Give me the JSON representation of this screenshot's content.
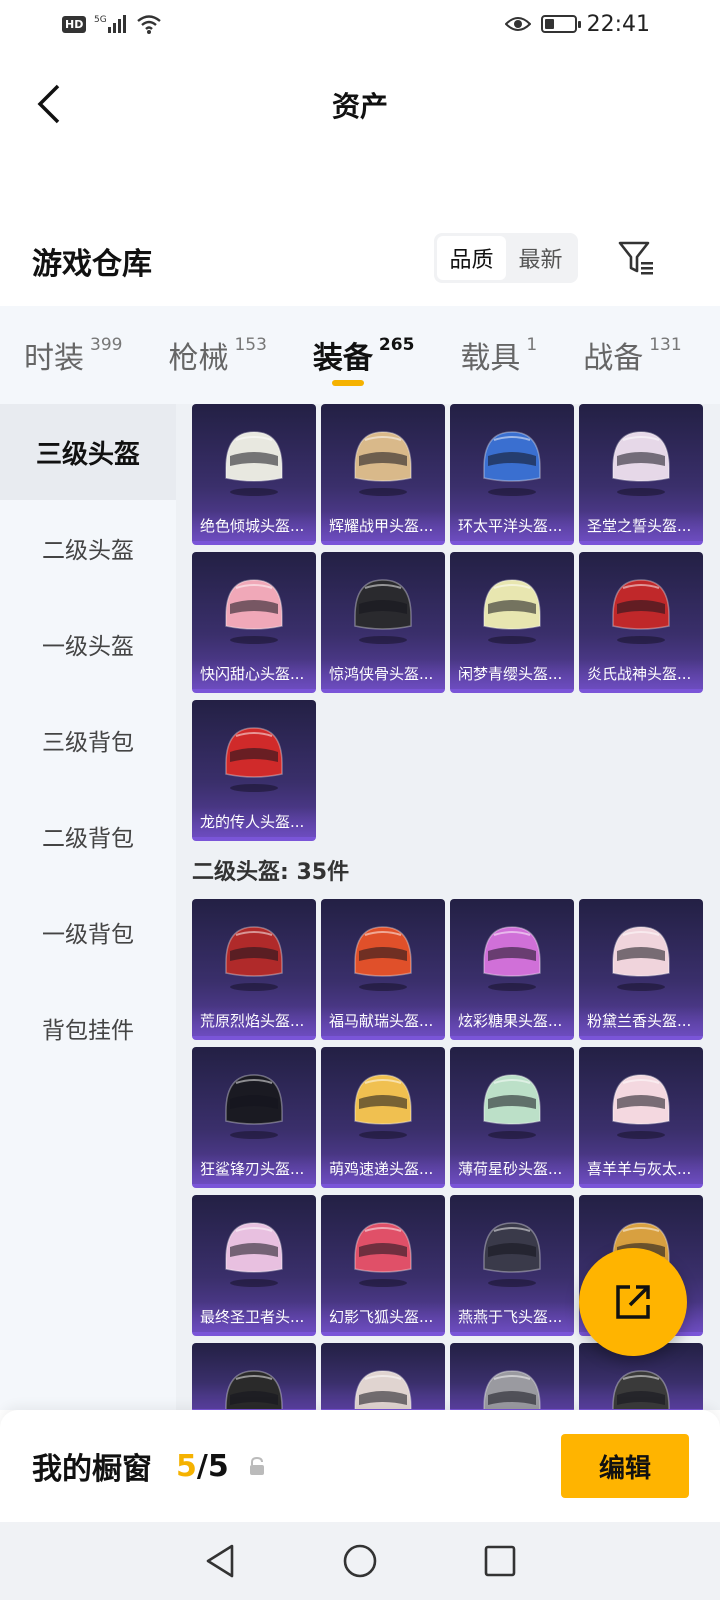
{
  "status_bar": {
    "network": "5G",
    "time": "22:41",
    "battery_level": 0.35
  },
  "header": {
    "title": "资产"
  },
  "warehouse": {
    "title": "游戏仓库",
    "sort_options": [
      "品质",
      "最新"
    ],
    "selected_sort": "品质"
  },
  "tabs": [
    {
      "label": "时装",
      "count": "399"
    },
    {
      "label": "枪械",
      "count": "153"
    },
    {
      "label": "装备",
      "count": "265",
      "active": true
    },
    {
      "label": "载具",
      "count": "1"
    },
    {
      "label": "战备",
      "count": "131"
    }
  ],
  "side_nav": [
    {
      "label": "三级头盔",
      "active": true
    },
    {
      "label": "二级头盔"
    },
    {
      "label": "一级头盔"
    },
    {
      "label": "三级背包"
    },
    {
      "label": "二级背包"
    },
    {
      "label": "一级背包"
    },
    {
      "label": "背包挂件"
    }
  ],
  "level3_items": [
    {
      "name": "绝色倾城头盔...",
      "color": "#e8e8e0"
    },
    {
      "name": "辉耀战甲头盔...",
      "color": "#d9b98a"
    },
    {
      "name": "环太平洋头盔...",
      "color": "#3a6fd0"
    },
    {
      "name": "圣堂之誓头盔...",
      "color": "#e6d8e8"
    },
    {
      "name": "快闪甜心头盔...",
      "color": "#f0a8b8"
    },
    {
      "name": "惊鸿侠骨头盔...",
      "color": "#2a2a2e"
    },
    {
      "name": "闲梦青缨头盔...",
      "color": "#e8e6b0"
    },
    {
      "name": "炎氏战神头盔...",
      "color": "#c0282a"
    },
    {
      "name": "龙的传人头盔...",
      "color": "#d02a2a"
    }
  ],
  "level2_section": {
    "label": "二级头盔: 35件"
  },
  "level2_items": [
    {
      "name": "荒原烈焰头盔...",
      "color": "#b02a2a"
    },
    {
      "name": "福马献瑞头盔...",
      "color": "#e0502a"
    },
    {
      "name": "炫彩糖果头盔...",
      "color": "#d070d8"
    },
    {
      "name": "粉黛兰香头盔...",
      "color": "#f0d4dc"
    },
    {
      "name": "狂鲨锋刃头盔...",
      "color": "#1a1a22"
    },
    {
      "name": "萌鸡速递头盔...",
      "color": "#f0c050"
    },
    {
      "name": "薄荷星砂头盔...",
      "color": "#bce0c8"
    },
    {
      "name": "喜羊羊与灰太...",
      "color": "#f4d8e0"
    },
    {
      "name": "最终圣卫者头...",
      "color": "#e8c0e0"
    },
    {
      "name": "幻影飞狐头盔...",
      "color": "#e05068"
    },
    {
      "name": "燕燕于飞头盔...",
      "color": "#3a3a4a"
    },
    {
      "name": "",
      "color": "#d8a040"
    }
  ],
  "bottom_partial": [
    {
      "color": "#2a2a2a"
    },
    {
      "color": "#e0d4d0"
    },
    {
      "color": "#9a9aa0"
    },
    {
      "color": "#3a3a3a"
    }
  ],
  "showcase": {
    "label": "我的橱窗",
    "current": "5",
    "sep": "/",
    "total": "5",
    "edit_label": "编辑"
  }
}
